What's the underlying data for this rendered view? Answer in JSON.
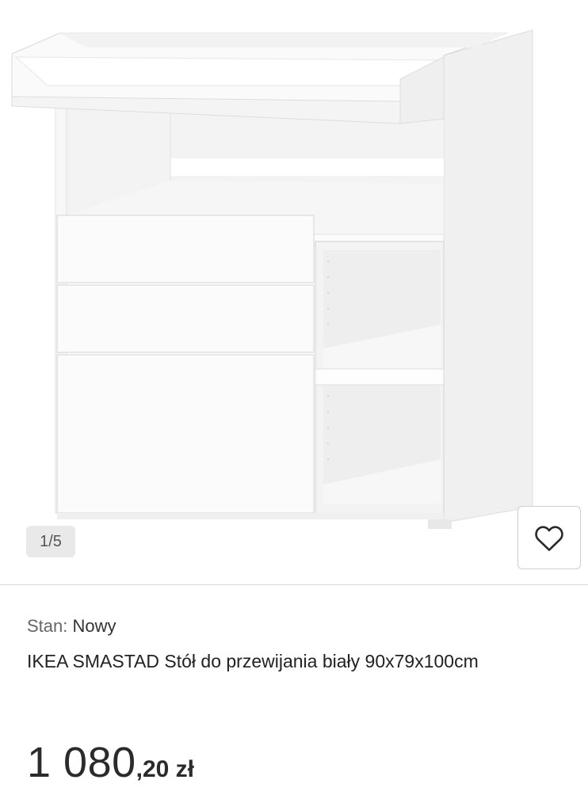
{
  "gallery": {
    "counter": "1/5",
    "image_subject": "white changing table with drawers and shelves",
    "favorite_icon": "heart-icon"
  },
  "listing": {
    "condition_label": "Stan:",
    "condition_value": "Nowy",
    "title": "IKEA SMASTAD Stół do przewijania biały 90x79x100cm",
    "price_integer": "1 080",
    "price_decimal": ",20 zł"
  },
  "colors": {
    "furniture": "#ffffff",
    "counter_bg": "#e9e9e9",
    "border": "#cfcfcf"
  }
}
